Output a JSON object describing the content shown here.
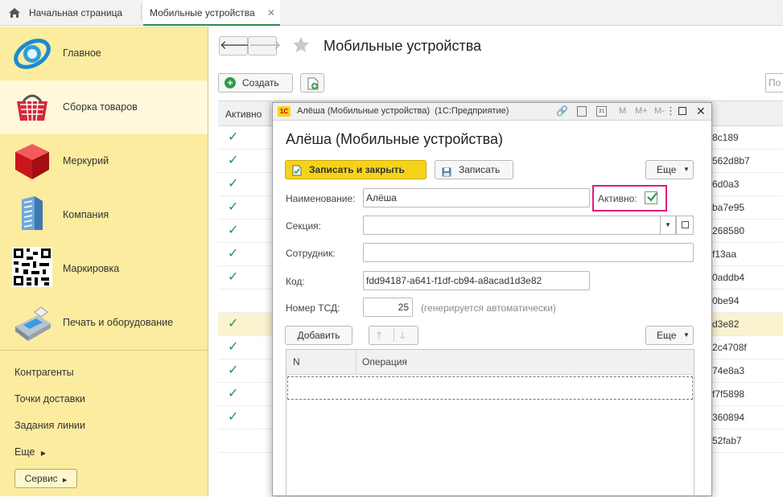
{
  "tabs": [
    {
      "label": "Начальная страница"
    },
    {
      "label": "Мобильные устройства"
    }
  ],
  "sidebar": {
    "sections": [
      {
        "label": "Главное",
        "icon": "globe-icon"
      },
      {
        "label": "Сборка товаров",
        "icon": "shopping-basket-icon"
      },
      {
        "label": "Меркурий",
        "icon": "red-cube-icon"
      },
      {
        "label": "Компания",
        "icon": "building-icon"
      },
      {
        "label": "Маркировка",
        "icon": "qr-code-icon"
      },
      {
        "label": "Печать и оборудование",
        "icon": "printer-terminal-icon"
      }
    ],
    "links": [
      {
        "label": "Контрагенты"
      },
      {
        "label": "Точки доставки"
      },
      {
        "label": "Задания линии"
      },
      {
        "label": "Еще"
      }
    ],
    "service_label": "Сервис"
  },
  "main": {
    "title": "Мобильные устройства",
    "create_label": "Создать",
    "search_placeholder": "По",
    "list": {
      "header_active": "Активно",
      "rows": [
        {
          "active": "✓",
          "code": "8c189"
        },
        {
          "active": "✓",
          "code": "562d8b7"
        },
        {
          "active": "✓",
          "code": "6d0a3"
        },
        {
          "active": "✓",
          "code": "ba7e95"
        },
        {
          "active": "✓",
          "code": "268580"
        },
        {
          "active": "✓",
          "code": "f13aa"
        },
        {
          "active": "✓",
          "code": "0addb4"
        },
        {
          "active": "",
          "code": "0be94"
        },
        {
          "active": "✓",
          "code": "d3e82"
        },
        {
          "active": "✓",
          "code": "2c4708f"
        },
        {
          "active": "✓",
          "code": "74e8a3"
        },
        {
          "active": "✓",
          "code": "f7f5898"
        },
        {
          "active": "✓",
          "code": "360894"
        },
        {
          "active": "",
          "code": "52fab7"
        }
      ]
    }
  },
  "dialog": {
    "window_title": "Алёша (Мобильные устройства)  (1С:Предприятие)",
    "heading": "Алёша (Мобильные устройства)",
    "toolbar_m": "M",
    "toolbar_mplus": "M+",
    "toolbar_mminus": "M-",
    "save_close_label": "Записать и закрыть",
    "save_label": "Записать",
    "more_label": "Еще",
    "name_label": "Наименование:",
    "name_value": "Алёша",
    "active_label": "Активно:",
    "section_label": "Секция:",
    "section_value": "",
    "employee_label": "Сотрудник:",
    "employee_value": "",
    "code_label": "Код:",
    "code_value": "fdd94187-a641-f1df-cb94-a8acad1d3e82",
    "tsd_label": "Номер ТСД:",
    "tsd_value": "25",
    "tsd_note": "(генерируется автоматически)",
    "add_label": "Добавить",
    "more2_label": "Еще",
    "table": {
      "col_n": "N",
      "col_operation": "Операция"
    }
  },
  "colors": {
    "sidebar_bg": "#fbeca0",
    "save_close_bg": "#f6d31a",
    "highlight_border": "#e0197d",
    "check_green": "#1e9a48"
  }
}
